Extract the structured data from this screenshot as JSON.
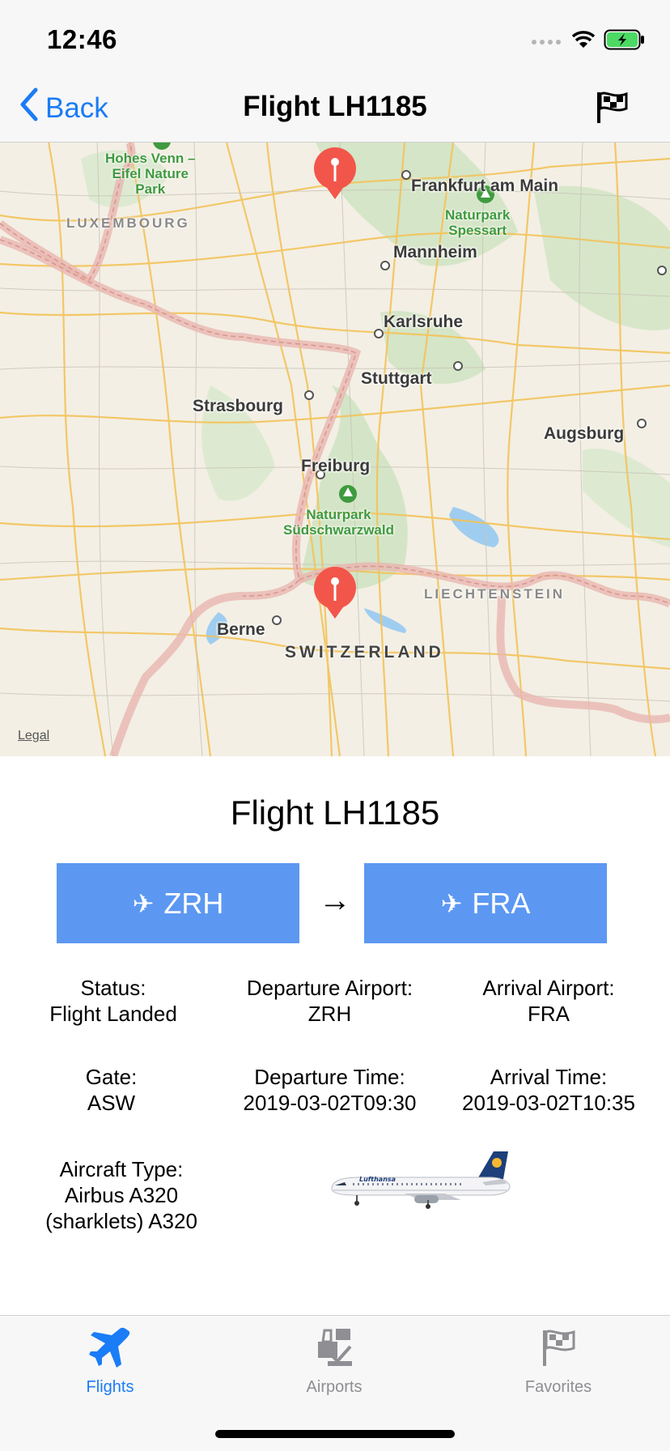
{
  "status_bar": {
    "time": "12:46"
  },
  "nav": {
    "back_label": "Back",
    "title": "Flight LH1185"
  },
  "map": {
    "cities": [
      {
        "name": "Frankfurt am Main"
      },
      {
        "name": "Mannheim"
      },
      {
        "name": "Karlsruhe"
      },
      {
        "name": "Stuttgart"
      },
      {
        "name": "Strasbourg"
      },
      {
        "name": "Augsburg"
      },
      {
        "name": "Freiburg"
      },
      {
        "name": "Berne"
      }
    ],
    "countries": [
      "LUXEMBOURG",
      "LIECHTENSTEIN",
      "SWITZERLAND"
    ],
    "parks": [
      "Hohes Venn –\nEifel Nature\nPark",
      "Naturpark\nSpessart",
      "Naturpark\nSüdschwarzwald"
    ],
    "legal": "Legal",
    "pin_color": "#f2564a"
  },
  "flight": {
    "heading": "Flight LH1185",
    "departure_button": "ZRH",
    "arrival_button": "FRA",
    "arrow": "→",
    "status_label": "Status:",
    "status_value": "Flight Landed",
    "departure_airport_label": "Departure Airport:",
    "departure_airport_value": "ZRH",
    "arrival_airport_label": "Arrival Airport:",
    "arrival_airport_value": "FRA",
    "gate_label": "Gate:",
    "gate_value": "ASW",
    "departure_time_label": "Departure Time:",
    "departure_time_value": "2019-03-02T09:30",
    "arrival_time_label": "Arrival Time:",
    "arrival_time_value": "2019-03-02T10:35",
    "aircraft_type_label": "Aircraft Type:",
    "aircraft_type_value_line1": "Airbus A320",
    "aircraft_type_value_line2": "(sharklets) A320",
    "aircraft_livery": "Lufthansa"
  },
  "tabs": [
    {
      "label": "Flights",
      "icon": "airplane-icon",
      "active": true
    },
    {
      "label": "Airports",
      "icon": "airport-icon",
      "active": false
    },
    {
      "label": "Favorites",
      "icon": "flag-icon",
      "active": false
    }
  ],
  "colors": {
    "accent": "#1a7cf6",
    "button_bg": "#5c98f2",
    "inactive_tab": "#8e8e93",
    "pin": "#f2564a"
  }
}
